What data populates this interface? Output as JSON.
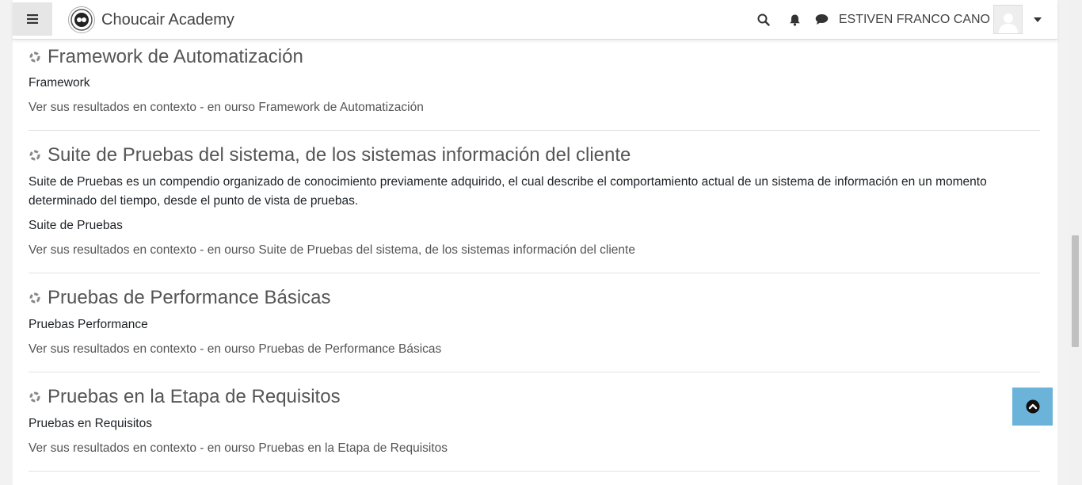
{
  "header": {
    "site_name": "Choucair Academy",
    "user_name": "ESTIVEN FRANCO CANO"
  },
  "results": [
    {
      "title": "Framework de Automatización",
      "description": "",
      "category": "Framework",
      "context": "Ver sus resultados en contexto - en ourso Framework de Automatización"
    },
    {
      "title": "Suite de Pruebas del sistema, de los sistemas información del cliente",
      "description": "Suite de Pruebas es un compendio organizado de conocimiento previamente adquirido, el cual describe el comportamiento actual de un sistema de información en un momento determinado del tiempo, desde el punto de vista de pruebas.",
      "category": "Suite de Pruebas",
      "context": "Ver sus resultados en contexto - en ourso Suite de Pruebas del sistema, de los sistemas información del cliente"
    },
    {
      "title": "Pruebas de Performance Básicas",
      "description": "",
      "category": "Pruebas Performance",
      "context": "Ver sus resultados en contexto - en ourso Pruebas de Performance Básicas"
    },
    {
      "title": "Pruebas en la Etapa de Requisitos",
      "description": "",
      "category": "Pruebas en Requisitos",
      "context": "Ver sus resultados en contexto - en ourso Pruebas en la Etapa de Requisitos"
    }
  ],
  "colors": {
    "back_to_top": "#6bb3d9",
    "toggle_bg": "#e6e6e6",
    "divider": "#dee2e6"
  }
}
